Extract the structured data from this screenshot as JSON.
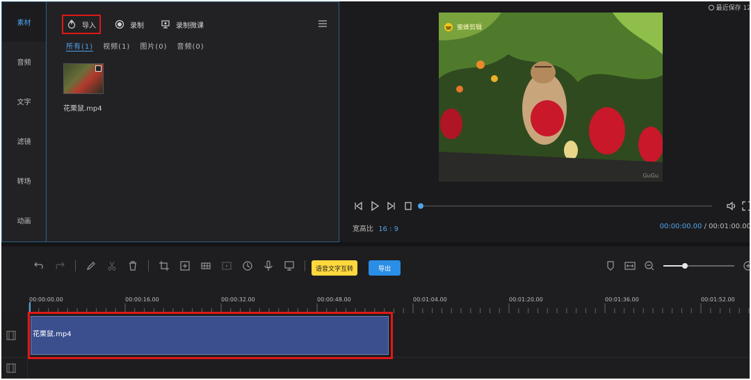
{
  "media_panel": {
    "tabs": [
      "素材",
      "音频",
      "文字",
      "滤镜",
      "转场",
      "动画"
    ],
    "active_tab": "素材",
    "toolbar": {
      "import_label": "导入",
      "record_label": "录制",
      "screen_record_label": "录制微课"
    },
    "filters": [
      "所有(1)",
      "视频(1)",
      "图片(0)",
      "音频(0)"
    ],
    "active_filter": "所有(1)",
    "items": [
      {
        "name": "花栗鼠.mp4"
      }
    ]
  },
  "preview": {
    "save_status": "最近保存 12",
    "video_logo": "蜜蜂剪辑",
    "watermark": "GuGu",
    "aspect_label": "宽高比",
    "aspect_value": "16 : 9",
    "current_time": "00:00:00.00",
    "separator": "/",
    "total_time": "00:01:00.00",
    "progress": 0.0
  },
  "timeline_toolbar": {
    "voice_button": "语音文字互转",
    "export_button": "导出",
    "zoom_level": 0.3
  },
  "ruler": {
    "ticks": [
      "00:00:00.00",
      "00:00:16.00",
      "00:00:32.00",
      "00:00:48.00",
      "00:01:04.00",
      "00:01:20.00",
      "00:01:36.00",
      "00:01:52.00"
    ]
  },
  "tracks": {
    "clips": [
      {
        "name": "花栗鼠.mp4"
      }
    ]
  },
  "colors": {
    "accent": "#4fa3ea",
    "highlight": "#e01818",
    "voice_button": "#ffd83d",
    "export_button": "#2a8ee6",
    "clip": "#3b4f8f"
  }
}
